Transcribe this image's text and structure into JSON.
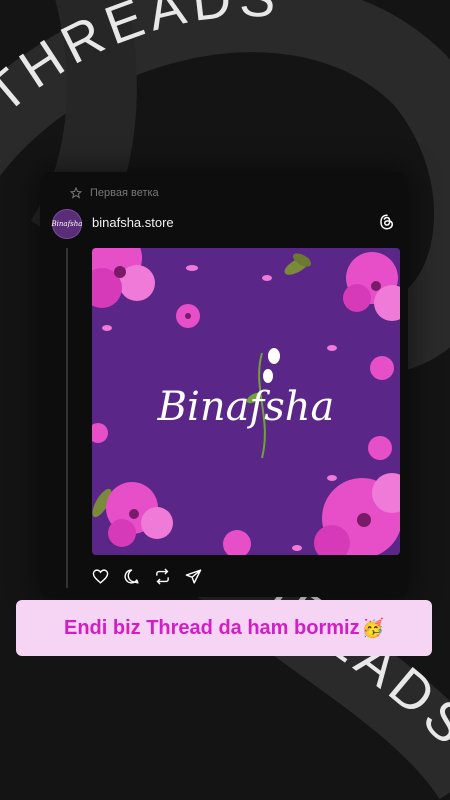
{
  "background": {
    "ring_text": "THREADS",
    "ring_color": "#2e2e2e",
    "ring_text_color": "#e8e8e8"
  },
  "post": {
    "thread_label": "Первая ветка",
    "username": "binafsha.store",
    "avatar_label": "Binafsha",
    "image": {
      "brand_text": "Binafsha",
      "background_color": "#5a2688",
      "flower_color": "#e64fc8"
    },
    "actions": [
      "heart-icon",
      "comment-icon",
      "repost-icon",
      "share-icon"
    ]
  },
  "caption": {
    "text": "Endi biz Thread da ham bormiz",
    "emoji": "🥳",
    "background_color": "#f6d4f3",
    "text_color": "#d01fc2"
  }
}
